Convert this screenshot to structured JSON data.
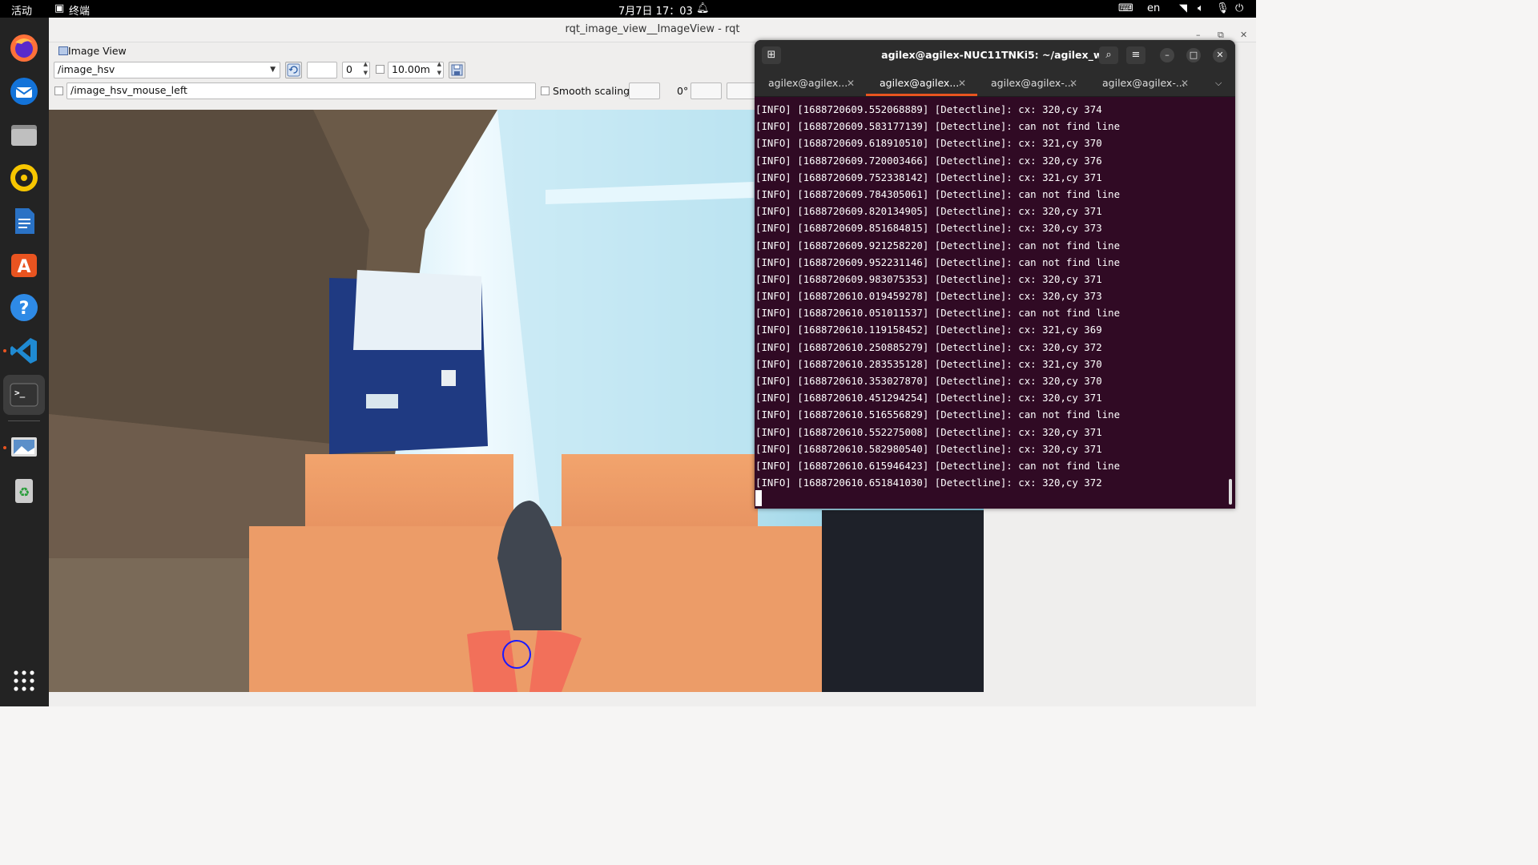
{
  "topbar": {
    "activities": "活动",
    "app_name": "终端",
    "clock": "7月7日  17：03",
    "keyboard_layout": "en"
  },
  "dock": {
    "items": [
      "firefox-icon",
      "thunderbird-icon",
      "files-icon",
      "rhythmbox-icon",
      "writer-icon",
      "app-center-icon",
      "help-icon",
      "vscode-icon",
      "terminal-icon",
      "image-viewer-icon",
      "trash-icon",
      "show-apps-icon"
    ]
  },
  "rqt": {
    "title": "rqt_image_view__ImageView - rqt",
    "plugin_label": "Image View",
    "topic": "/image_hsv",
    "spin_value": "0",
    "max_range": "10.00m",
    "mouse_topic": "/image_hsv_mouse_left",
    "smooth_scaling_label": "Smooth scaling",
    "rotation": "0°"
  },
  "terminal": {
    "title": "agilex@agilex-NUC11TNKi5: ~/agilex_ws",
    "tabs": [
      {
        "label": "agilex@agilex...",
        "active": false
      },
      {
        "label": "agilex@agilex...",
        "active": true
      },
      {
        "label": "agilex@agilex-...",
        "active": false
      },
      {
        "label": "agilex@agilex-...",
        "active": false
      }
    ],
    "lines": [
      "[INFO] [1688720609.552068889] [Detectline]: cx: 320,cy 374",
      "[INFO] [1688720609.583177139] [Detectline]: can not find line",
      "[INFO] [1688720609.618910510] [Detectline]: cx: 321,cy 370",
      "[INFO] [1688720609.720003466] [Detectline]: cx: 320,cy 376",
      "[INFO] [1688720609.752338142] [Detectline]: cx: 321,cy 371",
      "[INFO] [1688720609.784305061] [Detectline]: can not find line",
      "[INFO] [1688720609.820134905] [Detectline]: cx: 320,cy 371",
      "[INFO] [1688720609.851684815] [Detectline]: cx: 320,cy 373",
      "[INFO] [1688720609.921258220] [Detectline]: can not find line",
      "[INFO] [1688720609.952231146] [Detectline]: can not find line",
      "[INFO] [1688720609.983075353] [Detectline]: cx: 320,cy 371",
      "[INFO] [1688720610.019459278] [Detectline]: cx: 320,cy 373",
      "[INFO] [1688720610.051011537] [Detectline]: can not find line",
      "[INFO] [1688720610.119158452] [Detectline]: cx: 321,cy 369",
      "[INFO] [1688720610.250885279] [Detectline]: cx: 320,cy 372",
      "[INFO] [1688720610.283535128] [Detectline]: cx: 321,cy 370",
      "[INFO] [1688720610.353027870] [Detectline]: cx: 320,cy 370",
      "[INFO] [1688720610.451294254] [Detectline]: cx: 320,cy 371",
      "[INFO] [1688720610.516556829] [Detectline]: can not find line",
      "[INFO] [1688720610.552275008] [Detectline]: cx: 320,cy 371",
      "[INFO] [1688720610.582980540] [Detectline]: cx: 320,cy 371",
      "[INFO] [1688720610.615946423] [Detectline]: can not find line",
      "[INFO] [1688720610.651841030] [Detectline]: cx: 320,cy 372"
    ]
  }
}
